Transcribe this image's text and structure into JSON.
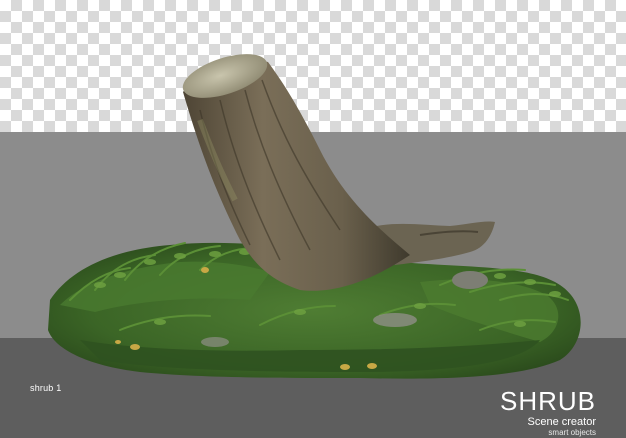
{
  "caption": "shrub 1",
  "brand": {
    "title": "SHRUB",
    "subtitle": "Scene creator",
    "tagline": "smart objects"
  },
  "colors": {
    "checker_light": "#ffffff",
    "checker_dark": "#d9d9d9",
    "background_mid": "#8c8c8c",
    "background_low": "#5e5e5e",
    "bark": "#6f6450",
    "moss": "#3f6a2a",
    "text": "#ffffff"
  }
}
